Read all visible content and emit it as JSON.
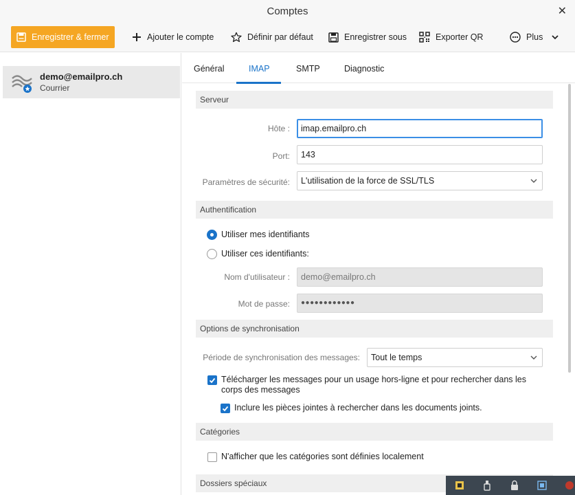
{
  "window": {
    "title": "Comptes",
    "close_glyph": "✕"
  },
  "toolbar": {
    "save_close": "Enregistrer & fermer",
    "add_account": "Ajouter le compte",
    "set_default": "Définir par défaut",
    "save_as": "Enregistrer sous",
    "export_qr": "Exporter QR",
    "more": "Plus"
  },
  "sidebar": {
    "account": {
      "email": "demo@emailpro.ch",
      "type": "Courrier"
    }
  },
  "tabs": [
    {
      "label": "Général",
      "active": false
    },
    {
      "label": "IMAP",
      "active": true
    },
    {
      "label": "SMTP",
      "active": false
    },
    {
      "label": "Diagnostic",
      "active": false
    }
  ],
  "server": {
    "section": "Serveur",
    "host_label": "Hôte :",
    "host_value": "imap.emailpro.ch",
    "port_label": "Port:",
    "port_value": "143",
    "security_label": "Paramètres de sécurité:",
    "security_value": "L'utilisation de la force de SSL/TLS"
  },
  "auth": {
    "section": "Authentification",
    "use_mine": "Utiliser mes identifiants",
    "use_these": "Utiliser ces identifiants:",
    "username_label": "Nom d'utilisateur :",
    "username_value": "demo@emailpro.ch",
    "password_label": "Mot de passe:",
    "password_value": "●●●●●●●●●●●●"
  },
  "sync": {
    "section": "Options de synchronisation",
    "period_label": "Période de synchronisation des messages:",
    "period_value": "Tout le temps",
    "download_offline": "Télécharger les messages pour un usage hors-ligne et pour rechercher dans les corps des messages",
    "include_attachments": "Inclure les pièces jointes à rechercher dans les documents joints."
  },
  "categories": {
    "section": "Catégories",
    "local_only": "N'afficher que les catégories sont définies localement"
  },
  "special_folders": {
    "section": "Dossiers spéciaux"
  },
  "colors": {
    "accent": "#1a73c9",
    "primary_button": "#f5a623"
  }
}
